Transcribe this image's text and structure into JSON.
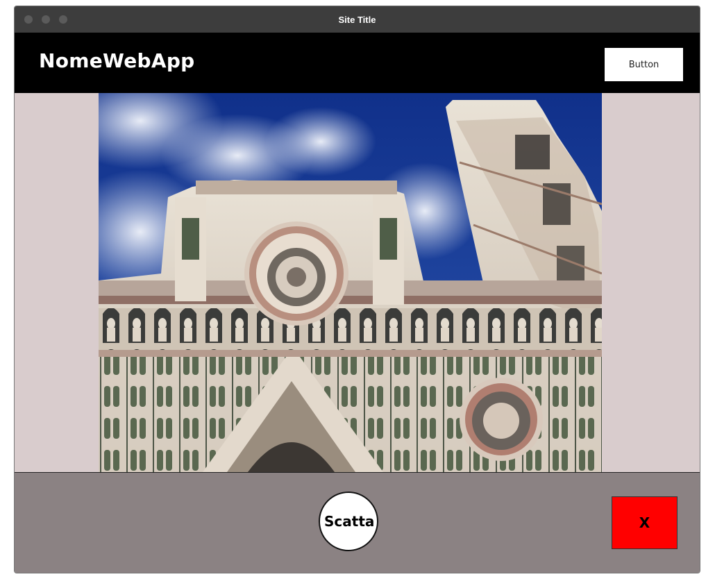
{
  "window": {
    "title": "Site Title"
  },
  "navbar": {
    "brand": "NomeWebApp",
    "button_label": "Button"
  },
  "main": {
    "image_alt": "Cattedrale di Santa Maria del Fiore"
  },
  "footer": {
    "shoot_label": "Scatta",
    "close_label": "X"
  },
  "colors": {
    "navbar_bg": "#000000",
    "content_bg": "#d9cccd",
    "footer_bg": "#8b8283",
    "close_bg": "#ff0000"
  }
}
